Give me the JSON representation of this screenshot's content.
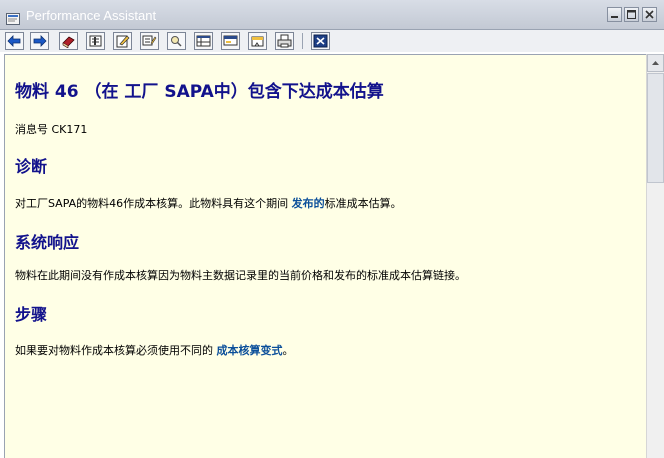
{
  "window": {
    "title": "Performance Assistant",
    "controls": [
      "minimize",
      "maximize",
      "close"
    ]
  },
  "toolbar": {
    "buttons": [
      {
        "name": "back-icon"
      },
      {
        "name": "forward-icon"
      },
      {
        "name": "book-icon"
      },
      {
        "name": "technical-info-icon"
      },
      {
        "name": "edit-icon"
      },
      {
        "name": "glossary-icon"
      },
      {
        "name": "print-preview-icon"
      },
      {
        "name": "table-icon"
      },
      {
        "name": "message-icon"
      },
      {
        "name": "bookmark-icon"
      },
      {
        "name": "print-icon"
      },
      {
        "name": "exit-icon"
      }
    ]
  },
  "doc": {
    "title": "物料 46 （在 工厂 SAPA中）包含下达成本估算",
    "message_number": "消息号 CK171",
    "diagnosis_heading": "诊断",
    "diagnosis_before": "对工厂SAPA的物料46作成本核算。此物料具有这个期间 ",
    "diagnosis_link": "发布的",
    "diagnosis_after": "标准成本估算。",
    "system_heading": "系统响应",
    "system_text": "物料在此期间没有作成本核算因为物料主数据记录里的当前价格和发布的标准成本估算链接。",
    "procedure_heading": "步骤",
    "procedure_before": "如果要对物料作成本核算必须使用不同的 ",
    "procedure_link": "成本核算变式",
    "procedure_after": "。"
  },
  "colors": {
    "heading": "#12128c",
    "link": "#0b4f9a",
    "background": "#ffffe6"
  }
}
